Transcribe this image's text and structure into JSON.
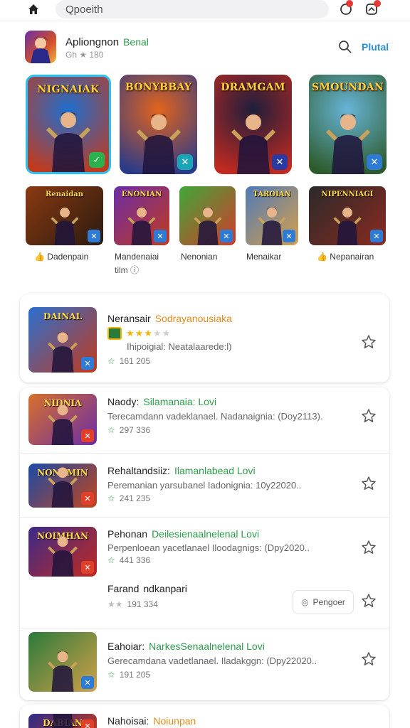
{
  "topbar": {
    "search_placeholder": "Qpoeith",
    "icons": [
      "home-icon",
      "notification-icon",
      "profile-icon"
    ],
    "accent": "#e53935"
  },
  "header": {
    "app_title": "Apliongnon",
    "app_title_accent": "Benal",
    "rating": "Gh ★ 180",
    "link": "Plutal"
  },
  "featured_big": [
    {
      "title": "NIGNAIAK",
      "colors": [
        "#1d6fd0",
        "#c23a1c"
      ],
      "badge": "#2bb24c"
    },
    {
      "title": "BONYBBAY",
      "colors": [
        "#e2641b",
        "#2a3a8a"
      ],
      "badge": "#1aa6b7"
    },
    {
      "title": "DRAMGAM",
      "colors": [
        "#1e1e3c",
        "#c22a20"
      ],
      "badge": "#2a3aa0"
    },
    {
      "title": "SMOUNDAN",
      "colors": [
        "#68b4d8",
        "#2c5a2a"
      ],
      "badge": "#2e7bd6"
    }
  ],
  "featured_small": [
    {
      "title": "Renaidan",
      "label": "Dadenpain",
      "colors": [
        "#8a3a12",
        "#2a1a10"
      ]
    },
    {
      "title": "ENONIAN",
      "label": "Mandenaiai",
      "sub": "tilm ⓘ",
      "colors": [
        "#6a2da8",
        "#c23a1c"
      ]
    },
    {
      "title": "",
      "label": "Nenonian",
      "colors": [
        "#3fa83a",
        "#d23a2a"
      ]
    },
    {
      "title": "TAROIAN",
      "label": "Menaikar",
      "colors": [
        "#4e7ab8",
        "#d8a04a"
      ]
    },
    {
      "title": "NIPENNIAGI",
      "label": "Nepanairan",
      "colors": [
        "#2a2a2a",
        "#8a2a20"
      ]
    }
  ],
  "list": [
    {
      "title": "Neransair",
      "accent": "Sodrayanousiaka",
      "accent_color": "#e58a1a",
      "desc": "Ihipoigial: Neatalaarede:l)",
      "rating_on": 3,
      "rating_off": 2,
      "downloads": "161 205",
      "colors": [
        "#2a6fd0",
        "#c23a1c"
      ],
      "icon_title": "DAINAL"
    },
    {
      "title": "Naody:",
      "accent": "Silamanaia: Lovi",
      "accent_color": "#2c9c4a",
      "desc": "Terecamdann vadeklanael. Nadanaignia: (Doy2113).",
      "downloads": "297 336",
      "colors": [
        "#d8702a",
        "#6a2da8"
      ],
      "icon_title": "NIDNIA"
    },
    {
      "title": "Rehaltandsiiz:",
      "accent": "Ilamanlabead Lovi",
      "accent_color": "#2c9c4a",
      "desc": "Peremanian yarsubanel Iadonignia: 10y22020..",
      "downloads": "241 235",
      "colors": [
        "#1a4aa8",
        "#c2461c"
      ],
      "icon_title": "NONAMIN"
    },
    {
      "title": "Pehonan",
      "accent": "Deilesienaalnelenal Lovi",
      "accent_color": "#2c9c4a",
      "desc": "Perpenloean yacetlanael Iloodagnigs: (Dpy2020..",
      "downloads": "441 336",
      "colors": [
        "#3a2a8a",
        "#c22a20"
      ],
      "icon_title": "NOIMHAN"
    },
    {
      "title": "Farand",
      "accent": "ndkanpari",
      "accent_color": "#222222",
      "downloads": "191 334",
      "pill": "Pengoer"
    },
    {
      "title": "Eahoiar:",
      "accent": "NarkesSenaalnelenal Lovi",
      "accent_color": "#2c9c4a",
      "desc": "Gerecamdana vadetlanael. Iladakggn: (Dpy22020..",
      "downloads": "191 205",
      "colors": [
        "#2a7a3a",
        "#d2a04a"
      ],
      "icon_title": ""
    },
    {
      "title": "Nahoisai:",
      "accent": "Noiunpan",
      "accent_color": "#e58a1a",
      "colors": [
        "#2a2a8a",
        "#c23a1c"
      ],
      "icon_title": "DABIAN"
    }
  ]
}
